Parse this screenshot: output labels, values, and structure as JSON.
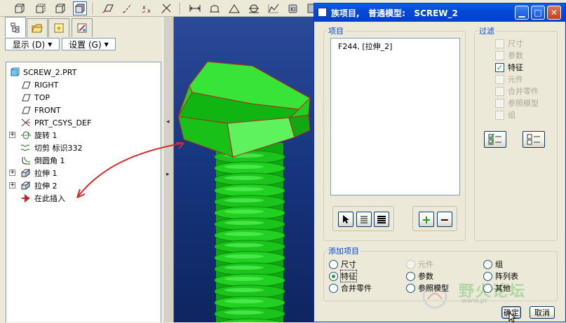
{
  "navigator": {
    "display_label": "显示 (D)",
    "settings_label": "设置 (G)",
    "tree": {
      "root": "SCREW_2.PRT",
      "items": [
        {
          "label": "RIGHT"
        },
        {
          "label": "TOP"
        },
        {
          "label": "FRONT"
        },
        {
          "label": "PRT_CSYS_DEF"
        },
        {
          "label": "旋转 1"
        },
        {
          "label": "切剪 标识332"
        },
        {
          "label": "倒圆角 1"
        },
        {
          "label": "拉伸 1"
        },
        {
          "label": "拉伸 2"
        },
        {
          "label": "在此插入"
        }
      ]
    }
  },
  "dialog": {
    "title": "族项目,   普通模型:   SCREW_2",
    "items_group": {
      "legend": "项目",
      "list": [
        "F244, [拉伸_2]"
      ]
    },
    "filter_group": {
      "legend": "过滤",
      "options": [
        {
          "label": "尺寸",
          "checked": false,
          "enabled": false
        },
        {
          "label": "参数",
          "checked": false,
          "enabled": false
        },
        {
          "label": "特征",
          "checked": true,
          "enabled": true
        },
        {
          "label": "元件",
          "checked": false,
          "enabled": false
        },
        {
          "label": "合并零件",
          "checked": false,
          "enabled": false
        },
        {
          "label": "参照模型",
          "checked": false,
          "enabled": false
        },
        {
          "label": "组",
          "checked": false,
          "enabled": false
        }
      ]
    },
    "add_group": {
      "legend": "添加项目",
      "options": [
        {
          "label": "尺寸",
          "selected": false,
          "enabled": true
        },
        {
          "label": "元件",
          "selected": false,
          "enabled": false
        },
        {
          "label": "组",
          "selected": false,
          "enabled": true
        },
        {
          "label": "特征",
          "selected": true,
          "enabled": true
        },
        {
          "label": "参数",
          "selected": false,
          "enabled": true
        },
        {
          "label": "阵列表",
          "selected": false,
          "enabled": true
        },
        {
          "label": "合并零件",
          "selected": false,
          "enabled": true
        },
        {
          "label": "参照模型",
          "selected": false,
          "enabled": true
        },
        {
          "label": "其他",
          "selected": false,
          "enabled": true
        }
      ]
    },
    "ok_label": "确定",
    "cancel_label": "取消"
  },
  "watermark": {
    "text": "野火论坛",
    "subtext": "www.pr"
  },
  "colors": {
    "model_green": "#19c619",
    "edge_red": "#cc2020",
    "viewport_blue": "#1a3a88",
    "dialog_title_blue": "#0349d6",
    "annotation_arrow": "#d42a2a"
  }
}
